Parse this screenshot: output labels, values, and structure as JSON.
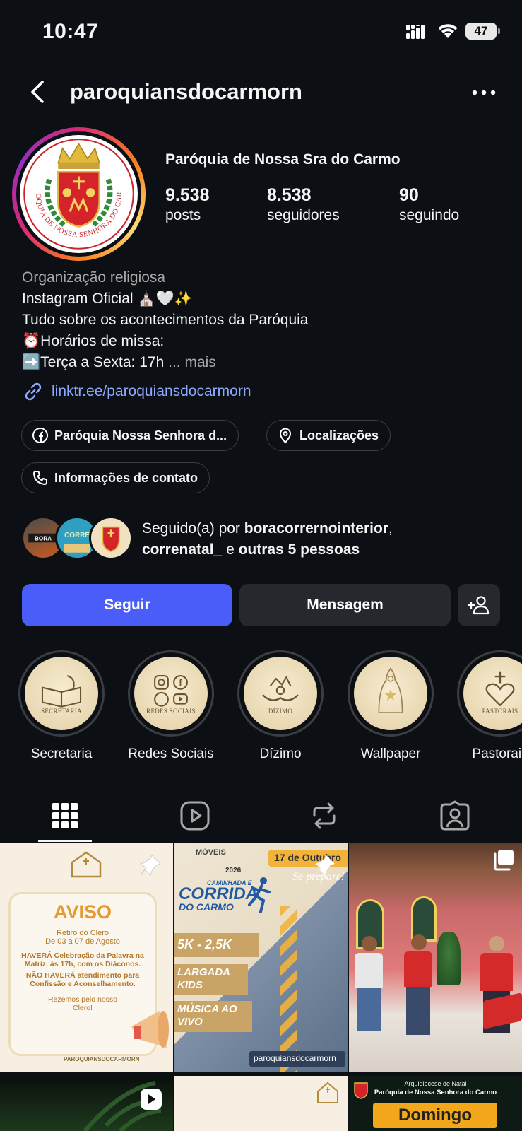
{
  "status_bar": {
    "time": "10:47",
    "battery": "47"
  },
  "header": {
    "username": "paroquiansdocarmorn"
  },
  "profile": {
    "display_name": "Paróquia de Nossa Sra do Carmo",
    "stats": [
      {
        "value": "9.538",
        "label": "posts"
      },
      {
        "value": "8.538",
        "label": "seguidores"
      },
      {
        "value": "90",
        "label": "seguindo"
      }
    ],
    "category": "Organização religiosa",
    "bio_lines": [
      "Instagram Oficial ⛪🤍✨",
      "Tudo sobre os acontecimentos da Paróquia",
      "⏰Horários de missa:",
      "➡️Terça a Sexta: 17h"
    ],
    "bio_more": "... mais",
    "link": "linktr.ee/paroquiansdocarmorn",
    "logo_text": "PARÓQUIA DE NOSSA SENHORA DO CARMO"
  },
  "chips": {
    "facebook": "Paróquia Nossa Senhora d...",
    "locations": "Localizações",
    "contact": "Informações de contato"
  },
  "followed_by": {
    "prefix": "Seguido(a) por ",
    "user1": "boracorrernointerior",
    "sep": ",",
    "user2": "correnatal_",
    "middle": " e ",
    "others": "outras 5 pessoas"
  },
  "actions": {
    "follow": "Seguir",
    "message": "Mensagem"
  },
  "highlights": [
    {
      "label": "Secretaria",
      "caption": "SECRETARIA"
    },
    {
      "label": "Redes Sociais",
      "caption": "REDES SOCIAIS"
    },
    {
      "label": "Dízimo",
      "caption": "DÍZIMO"
    },
    {
      "label": "Wallpaper",
      "caption": ""
    },
    {
      "label": "Pastorais",
      "caption": "PASTORAIS"
    }
  ],
  "posts": {
    "aviso": {
      "title": "AVISO",
      "line1": "Retiro do Clero",
      "line2": "De 03 a 07 de Agosto",
      "line3": "HAVERÁ Celebração da Palavra na Matriz, às 17h, com os Diáconos.",
      "line4": "NÃO HAVERÁ atendimento para Confissão e Aconselhamento.",
      "line5": "Rezemos pelo nosso Clero!",
      "handle": "PAROQUIANSDOCARMORN"
    },
    "corrida": {
      "brand": "MÓVEIS",
      "year": "2026",
      "date": "17 de Outubro",
      "subtitle": "Se prepare!",
      "title1": "CAMINHADA E",
      "title2": "CORRIDA",
      "title3": "DO CARMO",
      "item1": "5K - 2,5K",
      "item2": "LARGADA KIDS",
      "item3": "MÚSICA AO VIVO",
      "handle": "paroquiansdocarmorn"
    },
    "domingo": {
      "line1": "Arquidiocese de Natal",
      "line2": "Paróquia de Nossa Senhora do Carmo",
      "word": "Domingo"
    }
  }
}
